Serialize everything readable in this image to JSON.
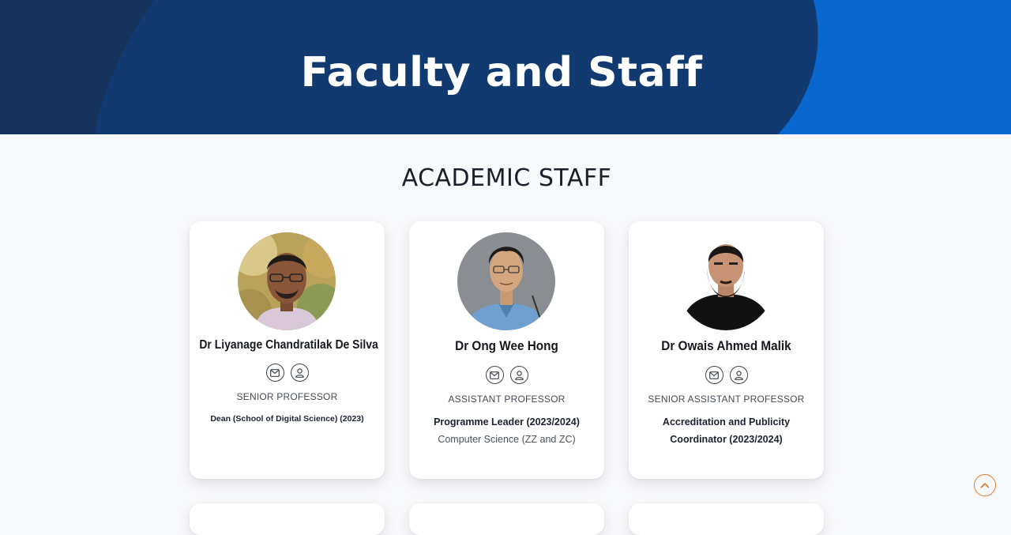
{
  "hero": {
    "title": "Faculty and Staff"
  },
  "section": {
    "title": "ACADEMIC STAFF"
  },
  "colors": {
    "hero_dark": "#103a70",
    "hero_accent": "#0a67d0",
    "scroll_top_accent": "#e07a2a"
  },
  "staff": [
    {
      "name": "Dr Liyanage Chandratilak De Silva",
      "position": "SENIOR PROFESSOR",
      "role": "Dean (School of Digital Science) (2023)",
      "department": "",
      "icons": [
        "email-icon",
        "profile-icon"
      ]
    },
    {
      "name": "Dr Ong Wee Hong",
      "position": "ASSISTANT PROFESSOR",
      "role": "Programme Leader (2023/2024)",
      "department": "Computer Science (ZZ and ZC)",
      "icons": [
        "email-icon",
        "profile-icon"
      ]
    },
    {
      "name": "Dr Owais Ahmed Malik",
      "position": "SENIOR ASSISTANT PROFESSOR",
      "role": "Accreditation and Publicity Coordinator (2023/2024)",
      "department": "",
      "icons": [
        "email-icon",
        "profile-icon"
      ]
    }
  ],
  "scroll_top": {
    "icon": "chevron-up-icon"
  }
}
